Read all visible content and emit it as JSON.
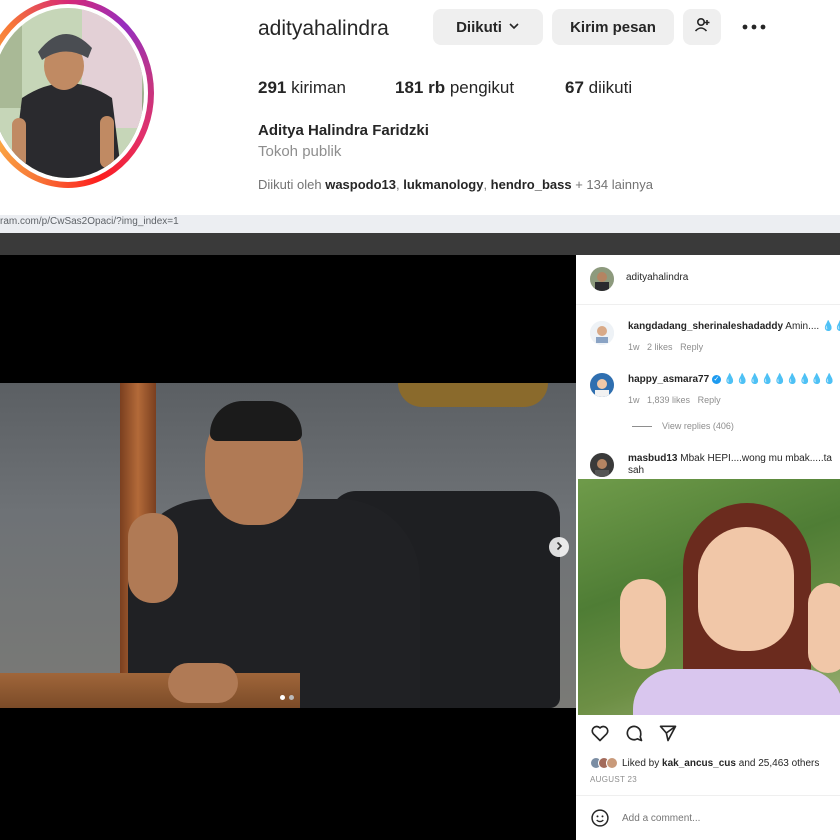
{
  "profile": {
    "username": "adityahalindra",
    "following_button": "Diikuti",
    "message_button": "Kirim pesan",
    "stats": {
      "posts_count": "291",
      "posts_label": "kiriman",
      "followers_count": "181 rb",
      "followers_label": "pengikut",
      "following_count": "67",
      "following_label": "diikuti"
    },
    "full_name": "Aditya Halindra Faridzki",
    "category": "Tokoh publik",
    "followed_by_prefix": "Diikuti oleh",
    "followed_by_users": [
      "waspodo13",
      "lukmanology",
      "hendro_bass"
    ],
    "followed_by_suffix": "+ 134 lainnya"
  },
  "url_bar": {
    "text": "ram.com/p/CwSas2Opaci/?img_index=1"
  },
  "post": {
    "author": "adityahalindra",
    "comments": [
      {
        "user": "kangdadang_sherinaleshadaddy",
        "text": "Amin....",
        "time": "1w",
        "likes": "2 likes",
        "reply": "Reply"
      },
      {
        "user": "happy_asmara77",
        "verified": true,
        "text": "💧💧💧💧💧💧💧💧💧",
        "time": "1w",
        "likes": "1,839 likes",
        "reply": "Reply",
        "view_replies": "View replies (406)"
      },
      {
        "user": "masbud13",
        "text": "Mbak HEPI....wong mu mbak.....ta",
        "text2": "sah"
      }
    ],
    "liked_by_prefix": "Liked by",
    "liked_by_user": "kak_ancus_cus",
    "liked_by_suffix": "and 25,463 others",
    "date": "AUGUST 23",
    "add_comment_placeholder": "Add a comment..."
  },
  "colors": {
    "brand_blue": "#1d9bf0",
    "button_gray": "#efefef",
    "text_muted": "#8e8e8e"
  }
}
